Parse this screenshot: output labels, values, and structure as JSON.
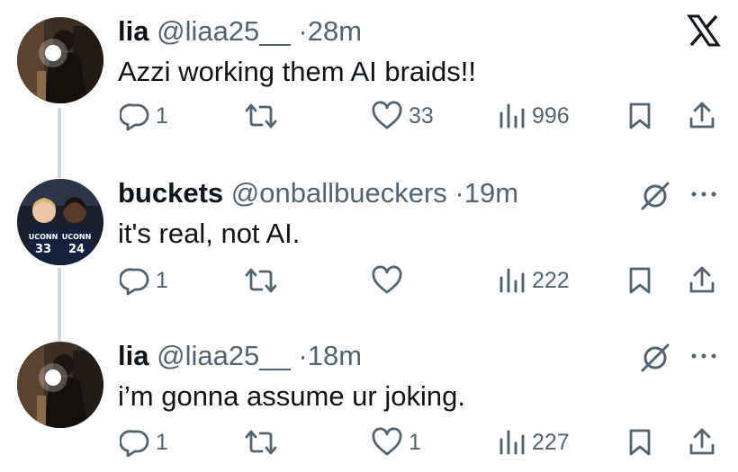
{
  "close_label": "X",
  "tweets": [
    {
      "name": "lia",
      "handle": "@liaa25__",
      "separator": "·",
      "time": "28m",
      "text": "Azzi working them AI braids!!",
      "replies": "1",
      "retweets": "",
      "likes": "33",
      "views": "996"
    },
    {
      "name": "buckets",
      "handle": "@onballbueckers",
      "separator": "·",
      "time": "19m",
      "text": "it's real, not AI.",
      "replies": "1",
      "retweets": "",
      "likes": "",
      "views": "222",
      "jersey_left": "33",
      "jersey_right": "24",
      "jersey_brand": "UCONN"
    },
    {
      "name": "lia",
      "handle": "@liaa25__",
      "separator": "·",
      "time": "18m",
      "text": "i’m gonna assume ur joking.",
      "replies": "1",
      "retweets": "",
      "likes": "1",
      "views": "227"
    }
  ],
  "colors": {
    "text_primary": "#0f1419",
    "text_secondary": "#536471",
    "thread_line": "#cfd9de"
  }
}
